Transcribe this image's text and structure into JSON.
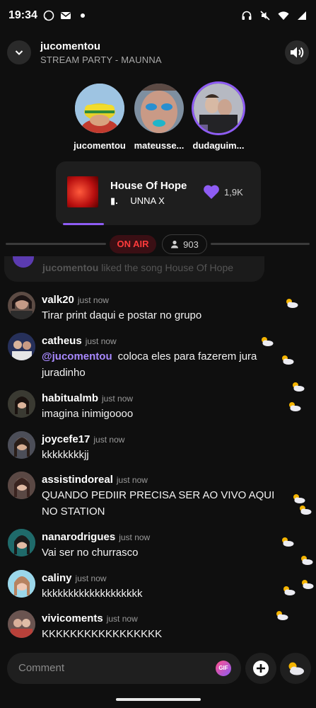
{
  "status_bar": {
    "time": "19:34"
  },
  "header": {
    "title": "jucomentou",
    "subtitle": "STREAM PARTY - MAUNNA"
  },
  "participants": [
    {
      "name": "jucomentou"
    },
    {
      "name": "mateusse..."
    },
    {
      "name": "dudaguim..."
    }
  ],
  "now_playing": {
    "title": "House Of Hope",
    "artist": "UNNA X",
    "artist_prefix": "▮.",
    "likes": "1,9K",
    "progress_fraction": 0.2
  },
  "live": {
    "badge": "ON AIR",
    "listeners": "903"
  },
  "system_message": {
    "user": "jucomentou",
    "text": " liked the song House Of Hope"
  },
  "messages": [
    {
      "user": "valk20",
      "time": "just now",
      "text": "Tirar print daqui e postar no grupo"
    },
    {
      "user": "catheus",
      "time": "just now",
      "mention": "@jucomentou",
      "text": "coloca eles para fazerem jura juradinho"
    },
    {
      "user": "habitualmb",
      "time": "just now",
      "text": "imagina inimigoooo"
    },
    {
      "user": "joycefe17",
      "time": "just now",
      "text": "kkkkkkkkjj"
    },
    {
      "user": "assistindoreal",
      "time": "just now",
      "text": "QUANDO PEDIIR PRECISA SER AO VIVO AQUI NO STATION"
    },
    {
      "user": "nanarodrigues",
      "time": "just now",
      "text": "Vai ser no churrasco"
    },
    {
      "user": "caliny",
      "time": "just now",
      "text": "kkkkkkkkkkkkkkkkkkk"
    },
    {
      "user": "vivicoments",
      "time": "just now",
      "text": "KKKKKKKKKKKKKKKKK"
    }
  ],
  "composer": {
    "placeholder": "Comment",
    "gif_label": "GIF"
  },
  "colors": {
    "accent": "#8e5cf4",
    "on_air": "#ff3b3b",
    "background": "#0f0f0f"
  }
}
